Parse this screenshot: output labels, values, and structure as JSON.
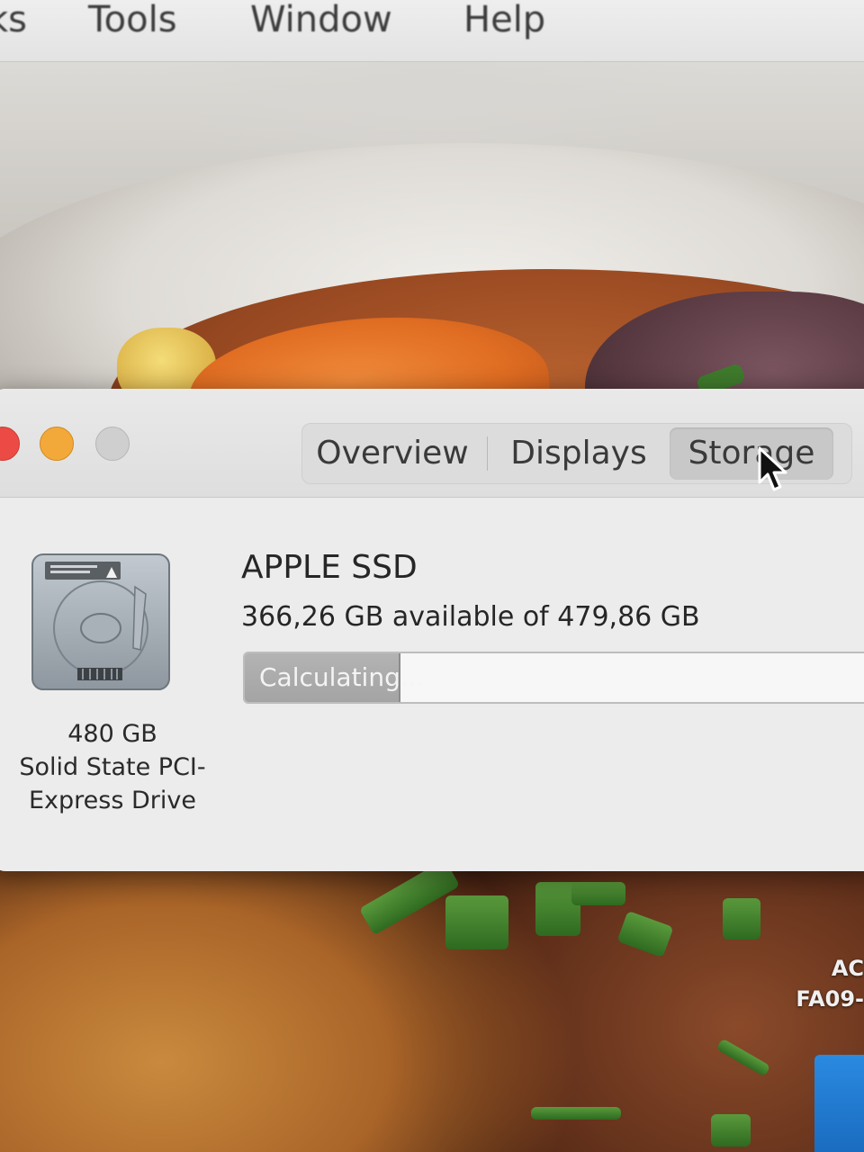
{
  "menubar": {
    "items": [
      "ks",
      "Tools",
      "Window",
      "Help"
    ]
  },
  "window": {
    "tabs": [
      "Overview",
      "Displays",
      "Storage"
    ],
    "selected_tab": "Storage",
    "drive": {
      "name": "APPLE SSD",
      "availability": "366,26 GB available of 479,86 GB",
      "bar_status": "Calculating...",
      "used_fraction": 0.237,
      "caption_size": "480 GB",
      "caption_type_line1": "Solid State PCI-",
      "caption_type_line2": "Express Drive"
    },
    "traffic_lights": {
      "close_color": "#ec4b45",
      "minimize_color": "#f3a93a",
      "zoom_color": "#cfcfcf"
    }
  },
  "desktop": {
    "label_line1": "AC",
    "label_line2": "FA09-"
  },
  "icons": [
    "hard-drive-icon",
    "warning-icon",
    "pointer-cursor-icon"
  ]
}
